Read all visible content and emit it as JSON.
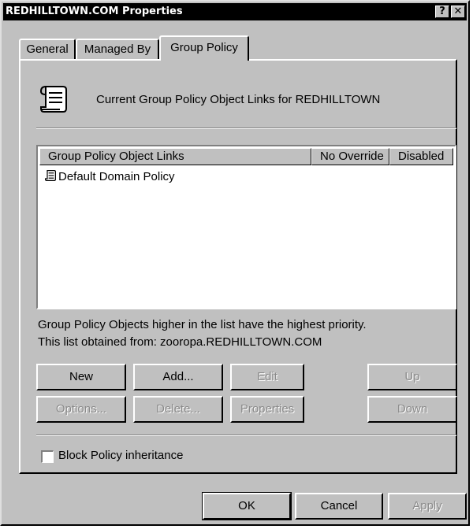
{
  "window": {
    "title": "REDHILLTOWN.COM Properties",
    "help_btn": "?",
    "close_btn": "✕"
  },
  "tabs": [
    {
      "label": "General"
    },
    {
      "label": "Managed By"
    },
    {
      "label": "Group Policy"
    }
  ],
  "panel": {
    "header_icon": "gpo-scroll-icon",
    "header_text": "Current Group Policy Object Links for REDHILLTOWN"
  },
  "list": {
    "columns": [
      "Group Policy Object Links",
      "No Override",
      "Disabled"
    ],
    "items": [
      {
        "icon": "gpo-scroll-icon",
        "name": "Default Domain Policy"
      }
    ]
  },
  "info": {
    "priority_note": "Group Policy Objects higher in the list have the highest priority.",
    "source_note": "This list obtained from: zooropa.REDHILLTOWN.COM"
  },
  "buttons": {
    "new": "New",
    "add": "Add...",
    "edit": "Edit",
    "up": "Up",
    "options": "Options...",
    "delete": "Delete...",
    "properties": "Properties",
    "down": "Down"
  },
  "block_inheritance": {
    "label": "Block Policy inheritance",
    "checked": false
  },
  "footer": {
    "ok": "OK",
    "cancel": "Cancel",
    "apply": "Apply"
  }
}
